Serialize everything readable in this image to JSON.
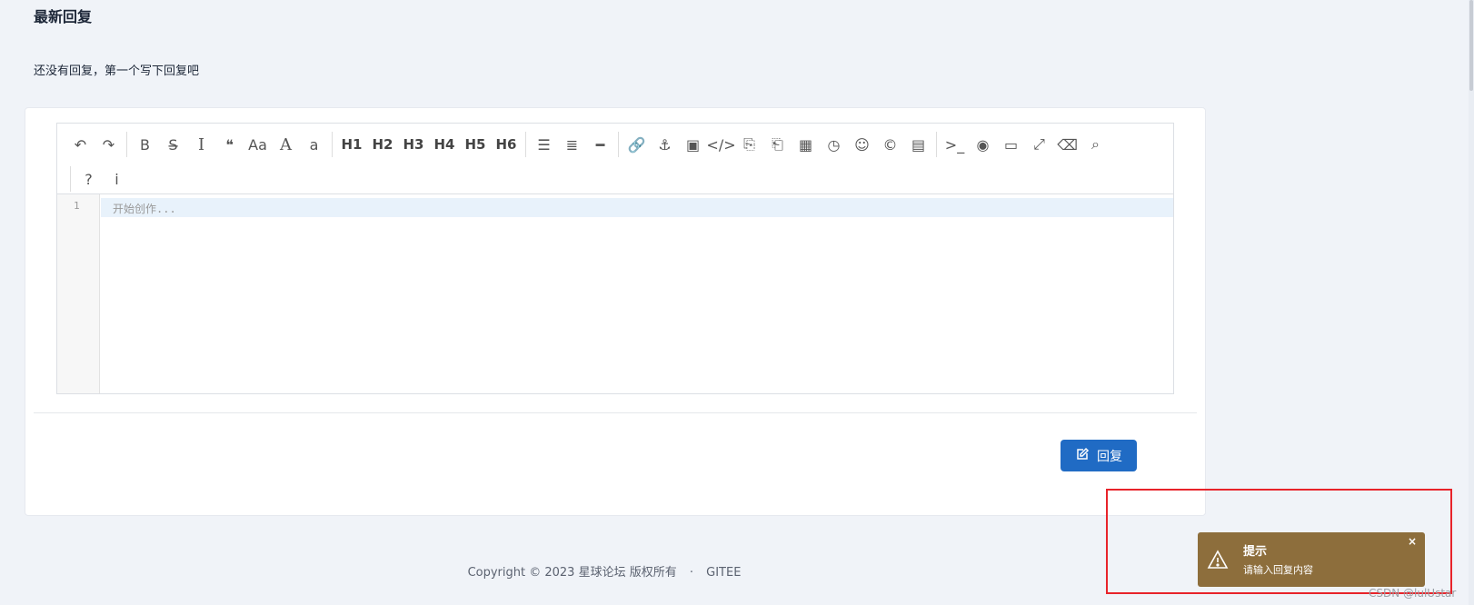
{
  "section": {
    "title": "最新回复",
    "empty_message": "还没有回复，第一个写下回复吧"
  },
  "editor": {
    "toolbar": [
      {
        "name": "undo-icon",
        "glyph": "↶"
      },
      {
        "name": "redo-icon",
        "glyph": "↷"
      },
      {
        "sep": true
      },
      {
        "name": "bold-icon",
        "glyph": "B"
      },
      {
        "name": "strikethrough-icon",
        "glyph": "S̶"
      },
      {
        "name": "italic-icon",
        "glyph": "I"
      },
      {
        "name": "quote-icon",
        "glyph": "❝"
      },
      {
        "name": "uppercase-icon",
        "glyph": "Aa"
      },
      {
        "name": "uppercase-word-icon",
        "glyph": "A"
      },
      {
        "name": "lowercase-icon",
        "glyph": "a"
      },
      {
        "sep": true
      },
      {
        "name": "h1-button",
        "glyph": "H1",
        "heading": true
      },
      {
        "name": "h2-button",
        "glyph": "H2",
        "heading": true
      },
      {
        "name": "h3-button",
        "glyph": "H3",
        "heading": true
      },
      {
        "name": "h4-button",
        "glyph": "H4",
        "heading": true
      },
      {
        "name": "h5-button",
        "glyph": "H5",
        "heading": true
      },
      {
        "name": "h6-button",
        "glyph": "H6",
        "heading": true
      },
      {
        "sep": true
      },
      {
        "name": "unordered-list-icon",
        "glyph": "☰"
      },
      {
        "name": "ordered-list-icon",
        "glyph": "≣"
      },
      {
        "name": "horizontal-rule-icon",
        "glyph": "━"
      },
      {
        "sep": true
      },
      {
        "name": "link-icon",
        "glyph": "🔗"
      },
      {
        "name": "anchor-icon",
        "glyph": "⚓"
      },
      {
        "name": "image-icon",
        "glyph": "▣"
      },
      {
        "name": "code-icon",
        "glyph": "</>"
      },
      {
        "name": "preformatted-code-icon",
        "glyph": "⎘"
      },
      {
        "name": "code-block-icon",
        "glyph": "⎗"
      },
      {
        "name": "table-icon",
        "glyph": "▦"
      },
      {
        "name": "datetime-icon",
        "glyph": "◷"
      },
      {
        "name": "emoji-icon",
        "glyph": "☺"
      },
      {
        "name": "html-entities-icon",
        "glyph": "©"
      },
      {
        "name": "pagebreak-icon",
        "glyph": "▤"
      },
      {
        "sep": true
      },
      {
        "name": "terminal-icon",
        "glyph": ">_"
      },
      {
        "name": "watch-icon",
        "glyph": "◉"
      },
      {
        "name": "preview-icon",
        "glyph": "▭"
      },
      {
        "name": "fullscreen-icon",
        "glyph": "⤢"
      },
      {
        "name": "clear-icon",
        "glyph": "⌫"
      },
      {
        "name": "search-icon",
        "glyph": "⌕"
      }
    ],
    "toolbar_row2": [
      {
        "name": "help-icon",
        "glyph": "?"
      },
      {
        "name": "info-icon",
        "glyph": "i"
      }
    ],
    "line_number": "1",
    "placeholder": "开始创作..."
  },
  "reply_button": {
    "label": "回复"
  },
  "footer": {
    "copyright": "Copyright © 2023 星球论坛 版权所有",
    "separator": "·",
    "link": "GITEE"
  },
  "toast": {
    "title": "提示",
    "message": "请输入回复内容",
    "close": "×",
    "color": "#8d6e3c"
  },
  "watermark": "CSDN @lulUstar",
  "colors": {
    "primary": "#206bc4",
    "background": "#f0f3f8",
    "highlight_box": "#e8232a"
  }
}
